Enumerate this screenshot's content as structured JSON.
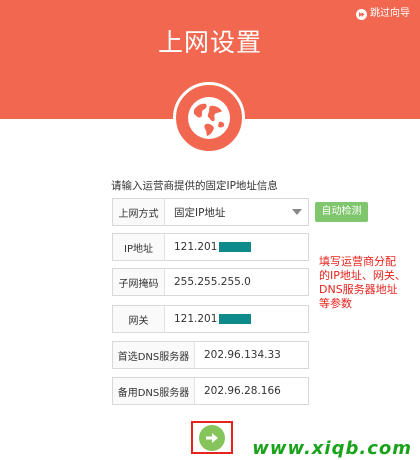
{
  "header": {
    "title": "上网设置",
    "skip_label": "跳过向导",
    "color": "#f2674f"
  },
  "form": {
    "subtitle": "请输入运营商提供的固定IP地址信息",
    "mode": {
      "label": "上网方式",
      "value": "固定IP地址"
    },
    "detect_button": "自动检测",
    "ip": {
      "label": "IP地址",
      "value": "121.201"
    },
    "mask": {
      "label": "子网掩码",
      "value": "255.255.255.0"
    },
    "gateway": {
      "label": "网关",
      "value": "121.201"
    },
    "dns1": {
      "label": "首选DNS服务器",
      "value": "202.96.134.33"
    },
    "dns2": {
      "label": "备用DNS服务器",
      "value": "202.96.28.166"
    }
  },
  "annotation": {
    "lines": [
      "填写运营商分配",
      "的IP地址、网关、",
      "DNS服务器地址",
      "等参数"
    ],
    "color": "#e8221c"
  },
  "watermark": "www.xiqb.com",
  "icons": {
    "skip": "skip-icon",
    "globe": "globe-icon",
    "next": "arrow-right-icon",
    "dropdown": "chevron-down-icon"
  }
}
